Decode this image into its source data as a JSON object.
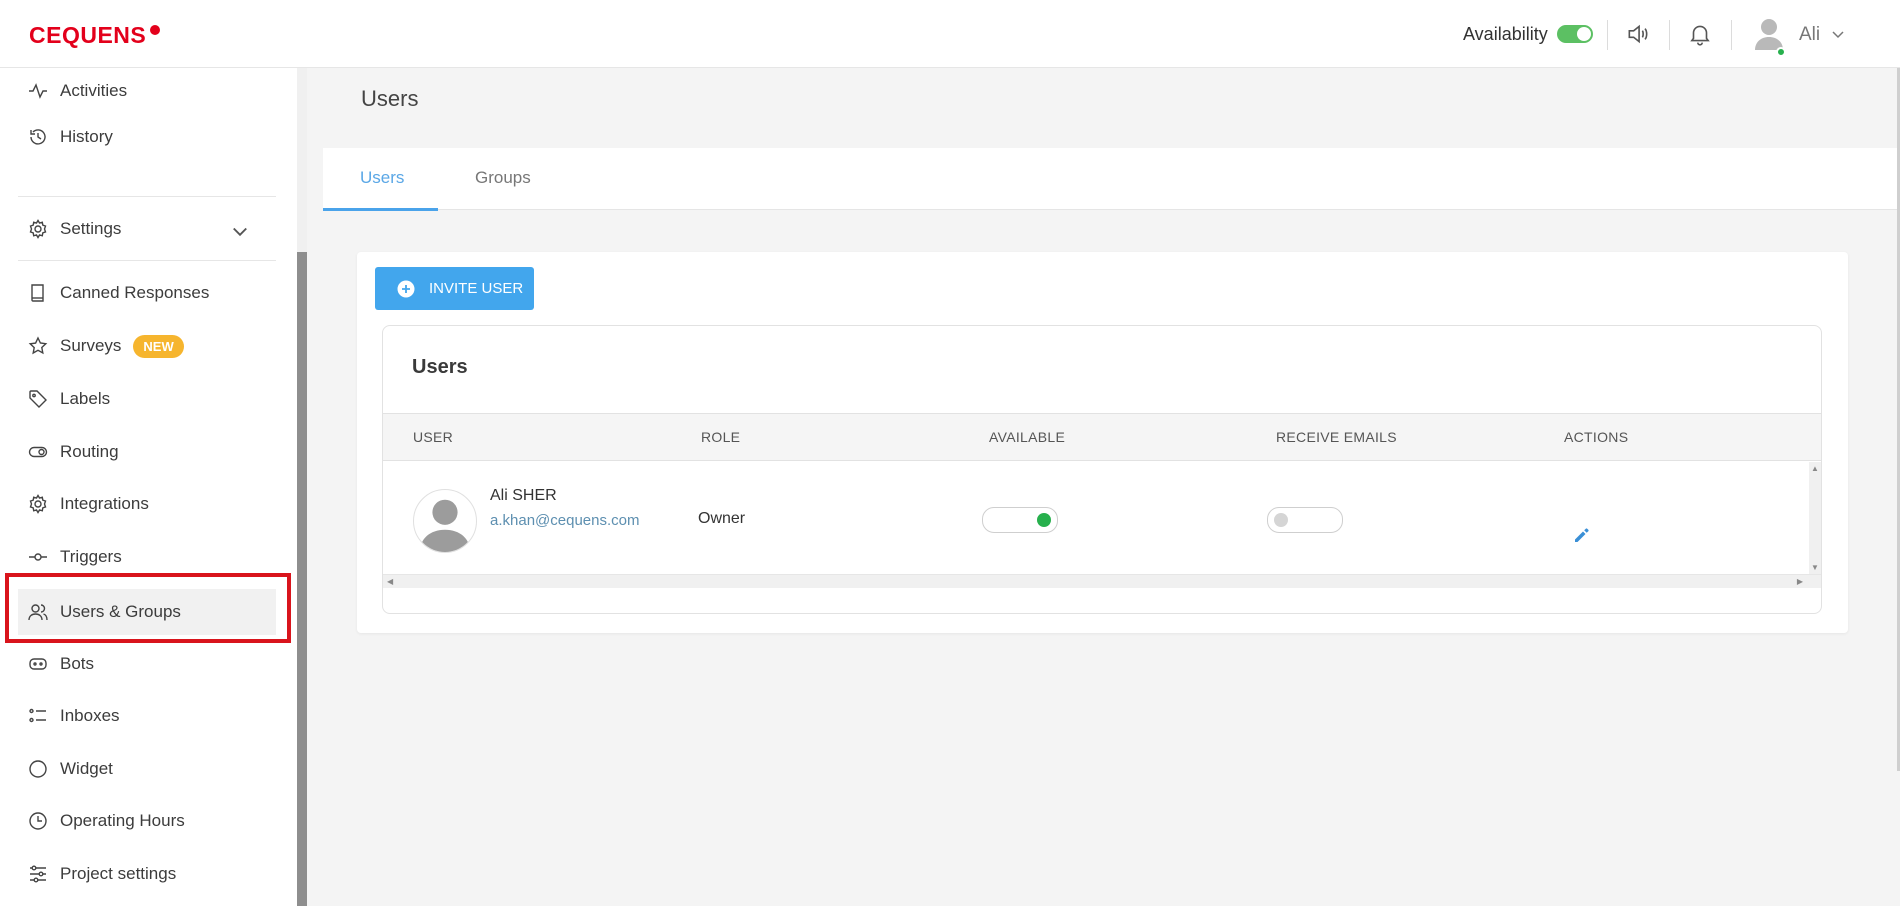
{
  "brand": {
    "name": "CEQUENS",
    "color": "#e3001b"
  },
  "header": {
    "availability_label": "Availability",
    "availability_on": true,
    "user_name": "Ali",
    "icons": [
      "speaker-icon",
      "bell-icon",
      "chevron-down-icon"
    ]
  },
  "sidebar": {
    "items": [
      {
        "label": "Activities",
        "icon": "activity-icon"
      },
      {
        "label": "History",
        "icon": "history-icon"
      },
      {
        "label": "Settings",
        "icon": "gear-icon"
      },
      {
        "label": "Canned Responses",
        "icon": "book-icon"
      },
      {
        "label": "Surveys",
        "icon": "star-icon",
        "badge": "NEW"
      },
      {
        "label": "Labels",
        "icon": "tag-icon"
      },
      {
        "label": "Routing",
        "icon": "toggle-icon"
      },
      {
        "label": "Integrations",
        "icon": "gear-icon"
      },
      {
        "label": "Triggers",
        "icon": "commit-icon"
      },
      {
        "label": "Users & Groups",
        "icon": "users-icon",
        "active": true
      },
      {
        "label": "Bots",
        "icon": "bot-icon"
      },
      {
        "label": "Inboxes",
        "icon": "list-icon"
      },
      {
        "label": "Widget",
        "icon": "circle-icon"
      },
      {
        "label": "Operating Hours",
        "icon": "clock-icon"
      },
      {
        "label": "Project settings",
        "icon": "sliders-icon"
      }
    ]
  },
  "page": {
    "title": "Users",
    "tabs": [
      {
        "label": "Users",
        "active": true
      },
      {
        "label": "Groups",
        "active": false
      }
    ],
    "invite_button": "INVITE USER",
    "users_section_title": "Users",
    "table": {
      "columns": [
        "USER",
        "ROLE",
        "AVAILABLE",
        "RECEIVE EMAILS",
        "ACTIONS"
      ],
      "rows": [
        {
          "name": "Ali SHER",
          "email": "a.khan@cequens.com",
          "role": "Owner",
          "available": true,
          "receive_emails": false
        }
      ]
    }
  },
  "colors": {
    "accent": "#42a6ed",
    "toggle_on": "#5cc063",
    "status_online": "#27b04d",
    "badge_new": "#f6b52e",
    "highlight": "#d9141c"
  }
}
